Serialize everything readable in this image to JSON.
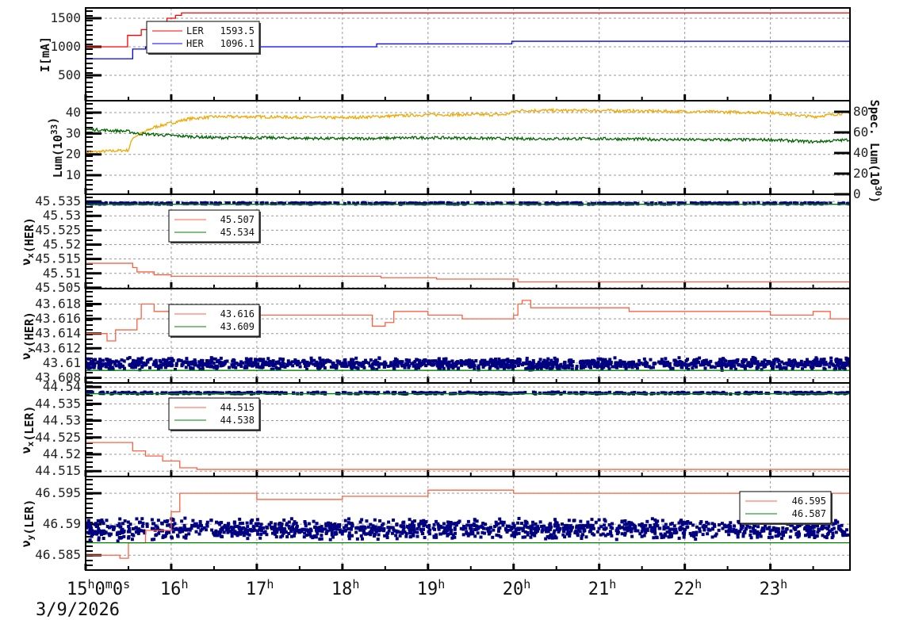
{
  "chart_data": [
    {
      "type": "line",
      "ylabel": {
        "main": "I[mA]",
        "sub": "",
        "rest": "",
        "sup": ""
      },
      "ylim": [
        56,
        1680
      ],
      "yticks": [
        {
          "v": 500,
          "t": "500"
        },
        {
          "v": 1000,
          "t": "1000"
        },
        {
          "v": 1500,
          "t": "1500"
        }
      ],
      "legend": {
        "placement": "top-left",
        "entries": [
          {
            "name": "LER",
            "value": "1593.5"
          },
          {
            "name": "HER",
            "value": "1096.1"
          }
        ]
      },
      "series": [
        {
          "name": "LER",
          "color": "#ff0000",
          "points": [
            [
              15,
              1000
            ],
            [
              15.47,
              1000
            ],
            [
              15.49,
              1200
            ],
            [
              15.65,
              1300
            ],
            [
              15.82,
              1380
            ],
            [
              15.95,
              1500
            ],
            [
              16.05,
              1550
            ],
            [
              16.12,
              1593
            ],
            [
              23.93,
              1593.5
            ]
          ]
        },
        {
          "name": "HER",
          "color": "#0000ff",
          "points": [
            [
              15,
              790
            ],
            [
              15.47,
              790
            ],
            [
              15.55,
              960
            ],
            [
              15.7,
              1000
            ],
            [
              18.37,
              1000
            ],
            [
              18.4,
              1050
            ],
            [
              19.95,
              1050
            ],
            [
              19.98,
              1096
            ],
            [
              23.93,
              1096.1
            ]
          ]
        }
      ]
    },
    {
      "type": "line",
      "ylabel": {
        "main": "Lum(10",
        "sup": "33",
        "rest": ")",
        "sub": ""
      },
      "ylabel_right": {
        "main": "Spec. Lum(10",
        "sup": "30",
        "rest": ")"
      },
      "ylim": [
        0.9,
        45.7
      ],
      "ylim_right": [
        0,
        90.8
      ],
      "yticks": [
        {
          "v": 10,
          "t": "10"
        },
        {
          "v": 20,
          "t": "20"
        },
        {
          "v": 30,
          "t": "30"
        },
        {
          "v": 40,
          "t": "40"
        }
      ],
      "yticks_right": [
        {
          "v": 0,
          "t": "0"
        },
        {
          "v": 20,
          "t": "20"
        },
        {
          "v": 40,
          "t": "40"
        },
        {
          "v": 60,
          "t": "60"
        },
        {
          "v": 80,
          "t": "80"
        }
      ],
      "series": [
        {
          "name": "Luminosity",
          "color": "#f0a800",
          "points": [
            [
              15,
              21
            ],
            [
              15.5,
              22
            ],
            [
              15.55,
              28
            ],
            [
              15.8,
              33
            ],
            [
              16.2,
              37
            ],
            [
              16.5,
              38
            ],
            [
              17,
              38
            ],
            [
              18,
              37.5
            ],
            [
              19,
              39
            ],
            [
              19.9,
              39
            ],
            [
              20.05,
              41
            ],
            [
              21,
              41
            ],
            [
              22,
              40.5
            ],
            [
              23,
              40
            ],
            [
              23.5,
              38
            ],
            [
              23.93,
              40
            ]
          ]
        },
        {
          "name": "Specific luminosity",
          "color": "#006400",
          "points": [
            [
              15,
              32
            ],
            [
              15.5,
              31
            ],
            [
              15.6,
              30
            ],
            [
              16,
              29
            ],
            [
              16.5,
              28
            ],
            [
              17,
              28
            ],
            [
              18,
              27.5
            ],
            [
              19,
              28
            ],
            [
              20,
              27.5
            ],
            [
              21,
              27.5
            ],
            [
              22,
              27
            ],
            [
              23,
              27
            ],
            [
              23.5,
              26
            ],
            [
              23.93,
              27
            ]
          ]
        }
      ]
    },
    {
      "type": "line",
      "ylabel": {
        "main": "ν",
        "sub": "x",
        "rest": "(HER)",
        "sup": ""
      },
      "ylim": [
        45.5047,
        45.5375
      ],
      "yticks": [
        {
          "v": 45.505,
          "t": "45.505"
        },
        {
          "v": 45.51,
          "t": "45.51"
        },
        {
          "v": 45.515,
          "t": "45.515"
        },
        {
          "v": 45.52,
          "t": "45.52"
        },
        {
          "v": 45.525,
          "t": "45.525"
        },
        {
          "v": 45.53,
          "t": "45.53"
        },
        {
          "v": 45.535,
          "t": "45.535"
        }
      ],
      "legend": {
        "placement": "top-left",
        "entries": [
          {
            "name": "",
            "value": "45.507",
            "color": "#ff6040"
          },
          {
            "name": "",
            "value": "45.534",
            "color": "#008000"
          }
        ]
      },
      "series": [
        {
          "name": "set",
          "color": "#ff6040",
          "points": [
            [
              15,
              45.5135
            ],
            [
              15.45,
              45.5135
            ],
            [
              15.55,
              45.512
            ],
            [
              15.6,
              45.5105
            ],
            [
              15.8,
              45.5095
            ],
            [
              16,
              45.509
            ],
            [
              18.3,
              45.509
            ],
            [
              18.45,
              45.5085
            ],
            [
              19.1,
              45.508
            ],
            [
              20,
              45.508
            ],
            [
              20.05,
              45.507
            ],
            [
              23.93,
              45.507
            ]
          ]
        },
        {
          "name": "ref",
          "color": "#008000",
          "points": [
            [
              15,
              45.534
            ],
            [
              23.93,
              45.534
            ]
          ]
        }
      ],
      "scatter": {
        "name": "measured",
        "color": "#000080",
        "center": 45.5343,
        "spread": 0.0003
      }
    },
    {
      "type": "line",
      "ylabel": {
        "main": "ν",
        "sub": "y",
        "rest": "(HER)",
        "sup": ""
      },
      "ylim": [
        43.6073,
        43.6201
      ],
      "yticks": [
        {
          "v": 43.608,
          "t": "43.608"
        },
        {
          "v": 43.61,
          "t": "43.61"
        },
        {
          "v": 43.612,
          "t": "43.612"
        },
        {
          "v": 43.614,
          "t": "43.614"
        },
        {
          "v": 43.616,
          "t": "43.616"
        },
        {
          "v": 43.618,
          "t": "43.618"
        }
      ],
      "legend": {
        "placement": "top-left",
        "entries": [
          {
            "name": "",
            "value": "43.616",
            "color": "#ff6040"
          },
          {
            "name": "",
            "value": "43.609",
            "color": "#008000"
          }
        ]
      },
      "series": [
        {
          "name": "set",
          "color": "#ff6040",
          "points": [
            [
              15,
              43.614
            ],
            [
              15.2,
              43.614
            ],
            [
              15.25,
              43.613
            ],
            [
              15.35,
              43.6145
            ],
            [
              15.55,
              43.6145
            ],
            [
              15.6,
              43.616
            ],
            [
              15.65,
              43.618
            ],
            [
              15.8,
              43.617
            ],
            [
              16,
              43.617
            ],
            [
              16.1,
              43.616
            ],
            [
              16.3,
              43.616
            ],
            [
              16.4,
              43.6165
            ],
            [
              18.3,
              43.6165
            ],
            [
              18.35,
              43.615
            ],
            [
              18.5,
              43.6155
            ],
            [
              18.6,
              43.617
            ],
            [
              19,
              43.6165
            ],
            [
              19.4,
              43.616
            ],
            [
              20,
              43.6165
            ],
            [
              20.05,
              43.618
            ],
            [
              20.1,
              43.6185
            ],
            [
              20.2,
              43.6175
            ],
            [
              21.3,
              43.6175
            ],
            [
              21.35,
              43.617
            ],
            [
              22.5,
              43.617
            ],
            [
              23,
              43.6165
            ],
            [
              23.5,
              43.617
            ],
            [
              23.7,
              43.616
            ],
            [
              23.93,
              43.616
            ]
          ]
        },
        {
          "name": "ref",
          "color": "#008000",
          "points": [
            [
              15,
              43.609
            ],
            [
              23.93,
              43.609
            ]
          ]
        }
      ],
      "scatter": {
        "name": "measured",
        "color": "#000080",
        "center": 43.6099,
        "spread": 0.0009
      }
    },
    {
      "type": "line",
      "ylabel": {
        "main": "ν",
        "sub": "x",
        "rest": "(LER)",
        "sup": ""
      },
      "ylim": [
        44.5134,
        44.5412
      ],
      "yticks": [
        {
          "v": 44.515,
          "t": "44.515"
        },
        {
          "v": 44.52,
          "t": "44.52"
        },
        {
          "v": 44.525,
          "t": "44.525"
        },
        {
          "v": 44.53,
          "t": "44.53"
        },
        {
          "v": 44.535,
          "t": "44.535"
        },
        {
          "v": 44.54,
          "t": "44.54"
        }
      ],
      "legend": {
        "placement": "top-left",
        "entries": [
          {
            "name": "",
            "value": "44.515",
            "color": "#ff6040"
          },
          {
            "name": "",
            "value": "44.538",
            "color": "#008000"
          }
        ]
      },
      "series": [
        {
          "name": "set",
          "color": "#ff6040",
          "points": [
            [
              15,
              44.5235
            ],
            [
              15.45,
              44.5235
            ],
            [
              15.55,
              44.521
            ],
            [
              15.7,
              44.5195
            ],
            [
              15.9,
              44.518
            ],
            [
              16.1,
              44.516
            ],
            [
              16.3,
              44.5155
            ],
            [
              23.93,
              44.5155
            ]
          ]
        },
        {
          "name": "ref",
          "color": "#008000",
          "points": [
            [
              15,
              44.538
            ],
            [
              23.93,
              44.538
            ]
          ]
        }
      ],
      "scatter": {
        "name": "measured",
        "color": "#000080",
        "center": 44.5382,
        "spread": 0.0003
      }
    },
    {
      "type": "line",
      "ylabel": {
        "main": "ν",
        "sub": "y",
        "rest": "(LER)",
        "sup": ""
      },
      "ylim": [
        46.5826,
        46.5977
      ],
      "yticks": [
        {
          "v": 46.585,
          "t": "46.585"
        },
        {
          "v": 46.59,
          "t": "46.59"
        },
        {
          "v": 46.595,
          "t": "46.595"
        }
      ],
      "legend": {
        "placement": "top-right",
        "entries": [
          {
            "name": "",
            "value": "46.595",
            "color": "#ff6040"
          },
          {
            "name": "",
            "value": "46.587",
            "color": "#008000"
          }
        ]
      },
      "series": [
        {
          "name": "set",
          "color": "#ff6040",
          "points": [
            [
              15,
              46.585
            ],
            [
              15.4,
              46.5845
            ],
            [
              15.5,
              46.587
            ],
            [
              15.7,
              46.589
            ],
            [
              16,
              46.592
            ],
            [
              16.1,
              46.595
            ],
            [
              17,
              46.594
            ],
            [
              18,
              46.5945
            ],
            [
              19,
              46.5955
            ],
            [
              20,
              46.595
            ],
            [
              23.93,
              46.5945
            ]
          ]
        },
        {
          "name": "ref",
          "color": "#008000",
          "points": [
            [
              15,
              46.587
            ],
            [
              23.93,
              46.587
            ]
          ]
        }
      ],
      "scatter": {
        "name": "measured",
        "color": "#000080",
        "center": 46.5892,
        "spread": 0.0018
      }
    }
  ],
  "x_axis": {
    "xlim": [
      15,
      23.93
    ],
    "ticks": [
      {
        "v": 15,
        "parts": [
          "15",
          "h",
          "0",
          "m",
          "0",
          "s"
        ]
      },
      {
        "v": 16,
        "parts": [
          "16",
          "h"
        ]
      },
      {
        "v": 17,
        "parts": [
          "17",
          "h"
        ]
      },
      {
        "v": 18,
        "parts": [
          "18",
          "h"
        ]
      },
      {
        "v": 19,
        "parts": [
          "19",
          "h"
        ]
      },
      {
        "v": 20,
        "parts": [
          "20",
          "h"
        ]
      },
      {
        "v": 21,
        "parts": [
          "21",
          "h"
        ]
      },
      {
        "v": 22,
        "parts": [
          "22",
          "h"
        ]
      },
      {
        "v": 23,
        "parts": [
          "23",
          "h"
        ]
      }
    ],
    "date": "3/9/2026"
  }
}
